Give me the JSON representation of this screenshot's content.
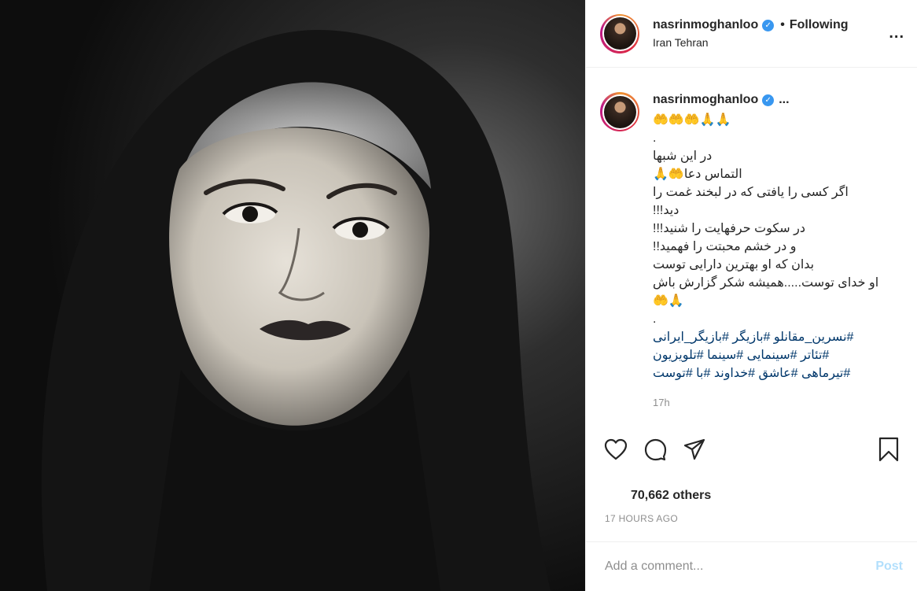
{
  "post": {
    "image_alt": "Black and white portrait of a woman wearing a dark headscarf",
    "colors": {
      "verified_blue": "#3897f0",
      "hashtag_blue": "#00376b",
      "muted_grey": "#8e8e8e",
      "post_disabled": "#b2dffc"
    }
  },
  "header": {
    "username": "nasrinmoghanloo",
    "verified_icon": "verified-badge-icon",
    "dot": "•",
    "follow_label": "Following",
    "location": "Iran Tehran",
    "more_label": "..."
  },
  "caption": {
    "username": "nasrinmoghanloo",
    "ellipsis": "...",
    "lines": [
      {
        "text": "🤲🤲🤲🙏🙏",
        "hashtag": false
      },
      {
        "text": ".",
        "hashtag": false
      },
      {
        "text": "در این شبها",
        "hashtag": false
      },
      {
        "text": "التماس دعا🤲🙏",
        "hashtag": false
      },
      {
        "text": "اگر کسی را یافتی که در لبخند غمت را",
        "hashtag": false
      },
      {
        "text": "دید!!!",
        "hashtag": false
      },
      {
        "text": "در سکوت حرفهایت را شنید!!!",
        "hashtag": false
      },
      {
        "text": "و در خشم محبتت را فهمید!!",
        "hashtag": false
      },
      {
        "text": "بدان که او بهترین دارایی توست",
        "hashtag": false
      },
      {
        "text": "او خدای توست.....همیشه شکر گزارش باش",
        "hashtag": false
      },
      {
        "text": "🤲🙏",
        "hashtag": false
      },
      {
        "text": ".",
        "hashtag": false
      },
      {
        "text": "#نسرین_مقانلو #بازیگر #بازیگر_ایرانی",
        "hashtag": true
      },
      {
        "text": "#تئاتر #سینمایی #سینما #تلویزیون",
        "hashtag": true
      },
      {
        "text": "#تیرماهی #عاشق #خداوند #با #توست",
        "hashtag": true
      }
    ],
    "time": "17h"
  },
  "actions": {
    "like_icon": "heart-icon",
    "comment_icon": "comment-icon",
    "share_icon": "share-icon",
    "save_icon": "bookmark-icon"
  },
  "likes": {
    "count_text": "70,662 others"
  },
  "timestamp": "17 HOURS AGO",
  "comment": {
    "placeholder": "Add a comment...",
    "post_label": "Post"
  }
}
